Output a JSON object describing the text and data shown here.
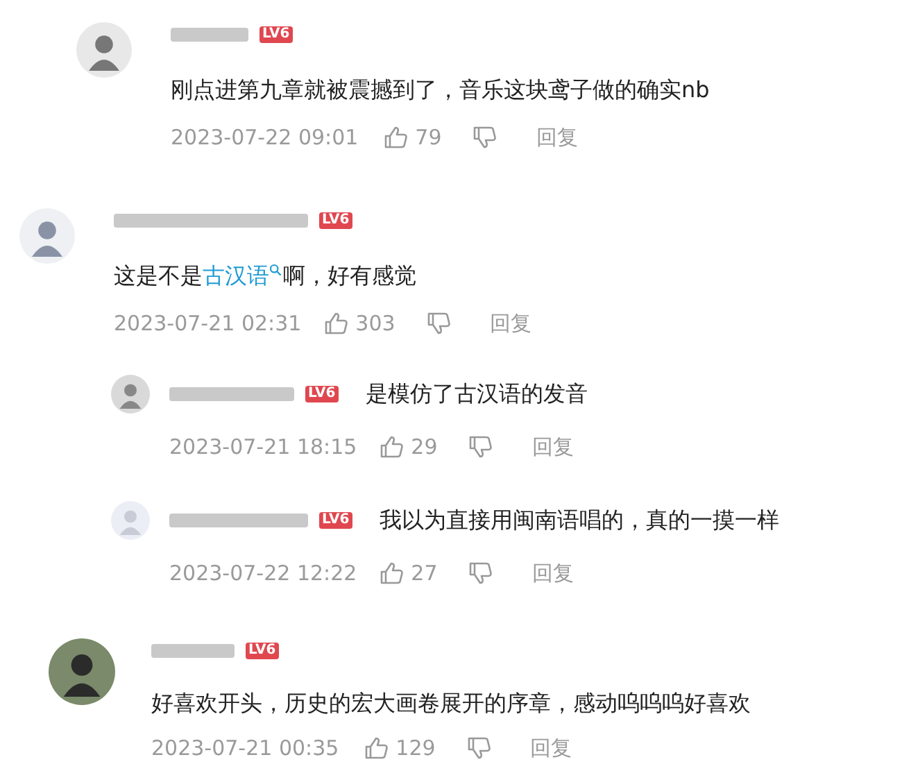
{
  "comments": [
    {
      "level_badge": "LV6",
      "parts": [
        {
          "kind": "plain",
          "text": "刚点进第九章就被震撼到了，音乐这块鸢子做的确实nb"
        }
      ],
      "time": "2023-07-22 09:01",
      "likes": "79",
      "reply_label": "回复"
    },
    {
      "level_badge": "LV6",
      "parts": [
        {
          "kind": "plain",
          "text": "这是不是"
        },
        {
          "kind": "search_link",
          "text": "古汉语"
        },
        {
          "kind": "plain",
          "text": "啊，好有感觉"
        }
      ],
      "time": "2023-07-21 02:31",
      "likes": "303",
      "reply_label": "回复",
      "children": [
        {
          "level_badge": "LV6",
          "parts": [
            {
              "kind": "plain",
              "text": "是模仿了古汉语的发音"
            }
          ],
          "time": "2023-07-21 18:15",
          "likes": "29",
          "reply_label": "回复"
        },
        {
          "level_badge": "LV6",
          "parts": [
            {
              "kind": "plain",
              "text": "我以为直接用闽南语唱的，真的一摸一样"
            }
          ],
          "time": "2023-07-22 12:22",
          "likes": "27",
          "reply_label": "回复"
        }
      ]
    },
    {
      "level_badge": "LV6",
      "parts": [
        {
          "kind": "plain",
          "text": "好喜欢开头，历史的宏大画卷展开的序章，感动呜呜呜好喜欢"
        }
      ],
      "time": "2023-07-21 00:35",
      "likes": "129",
      "reply_label": "回复"
    }
  ]
}
